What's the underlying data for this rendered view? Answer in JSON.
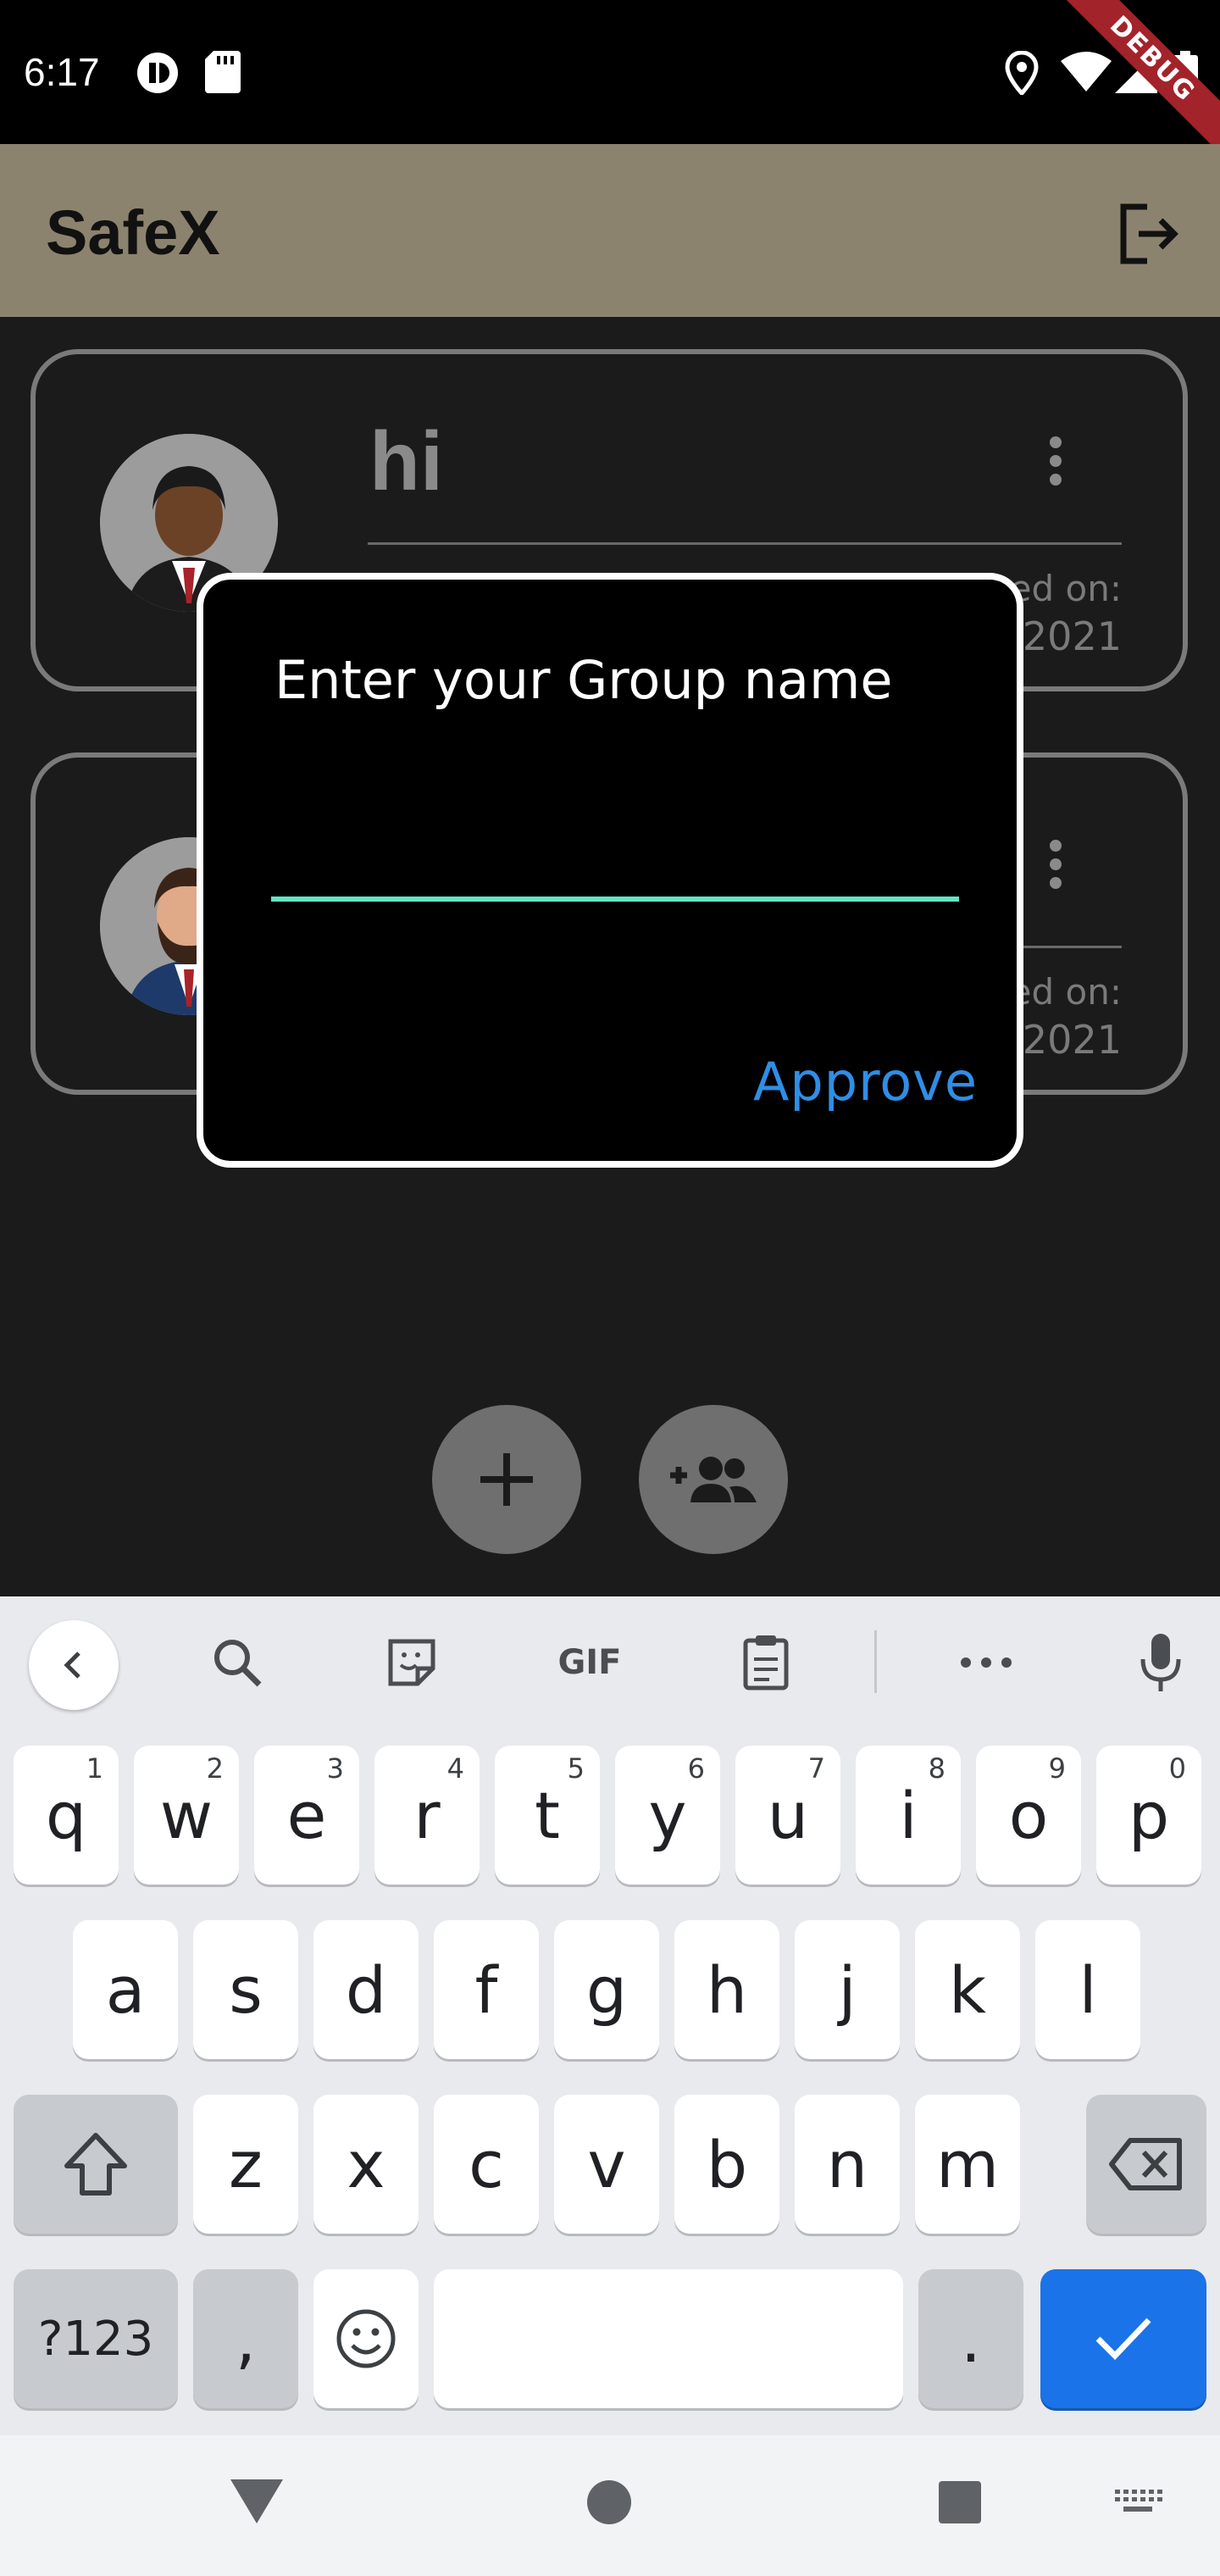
{
  "status_bar": {
    "time": "6:17",
    "debug_label": "DEBUG"
  },
  "app_bar": {
    "title": "SafeX",
    "logout_icon": "logout-icon"
  },
  "groups": [
    {
      "name": "hi",
      "created_label": "Created on:",
      "created_date": "/2021",
      "avatar": "man-dark-avatar"
    },
    {
      "name": "",
      "created_label": "Created on:",
      "created_date": "/2021",
      "avatar": "man-beard-avatar"
    }
  ],
  "fabs": {
    "add_icon": "plus-icon",
    "add_group_icon": "group-add-icon"
  },
  "dialog": {
    "title": "Enter your Group name",
    "input_value": "",
    "approve_label": "Approve",
    "accent_color": "#64e4c6",
    "button_color": "#2f8ee6"
  },
  "keyboard": {
    "toolbar": [
      "back-icon",
      "search-icon",
      "sticker-icon",
      "GIF",
      "clipboard-icon",
      "more-icon",
      "mic-icon"
    ],
    "row1": [
      {
        "key": "q",
        "hint": "1"
      },
      {
        "key": "w",
        "hint": "2"
      },
      {
        "key": "e",
        "hint": "3"
      },
      {
        "key": "r",
        "hint": "4"
      },
      {
        "key": "t",
        "hint": "5"
      },
      {
        "key": "y",
        "hint": "6"
      },
      {
        "key": "u",
        "hint": "7"
      },
      {
        "key": "i",
        "hint": "8"
      },
      {
        "key": "o",
        "hint": "9"
      },
      {
        "key": "p",
        "hint": "0"
      }
    ],
    "row2": [
      "a",
      "s",
      "d",
      "f",
      "g",
      "h",
      "j",
      "k",
      "l"
    ],
    "row3": [
      "z",
      "x",
      "c",
      "v",
      "b",
      "n",
      "m"
    ],
    "symbols_label": "?123",
    "comma": ",",
    "period": ".",
    "enter_color": "#1a73e8"
  },
  "nav_bar": [
    "back-triangle-icon",
    "home-circle-icon",
    "recents-square-icon",
    "keyboard-switch-icon"
  ]
}
